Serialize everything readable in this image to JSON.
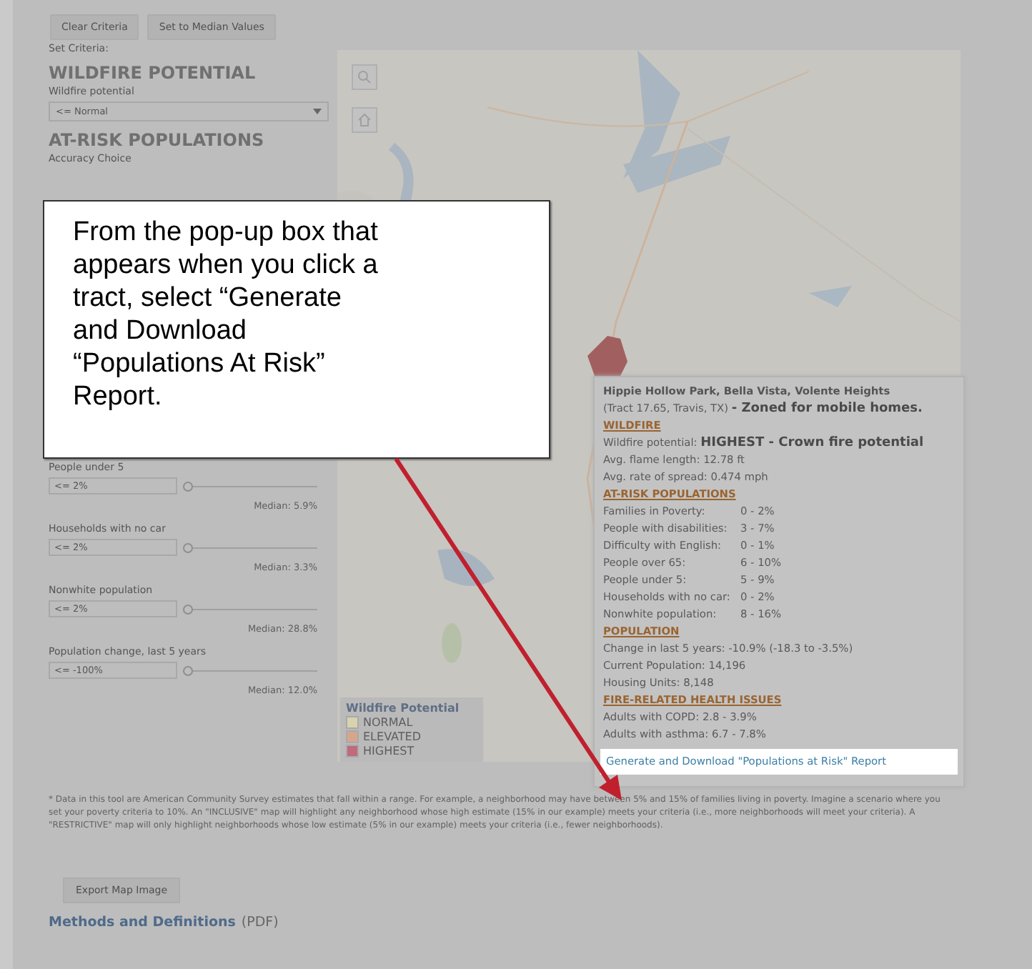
{
  "toolbar": {
    "buttons": [
      "Clear Criteria",
      "Set to Median Values"
    ]
  },
  "criteria_label": "Set Criteria:",
  "wildfire": {
    "heading": "WILDFIRE POTENTIAL",
    "label": "Wildfire potential",
    "value": "<= Normal"
  },
  "at_risk": {
    "heading": "AT-RISK POPULATIONS",
    "label": "Accuracy Choice"
  },
  "filters": [
    {
      "label": "People under 5",
      "value": "<= 2%",
      "level": 0,
      "median": "Median: 5.9%"
    },
    {
      "label": "Households with no car",
      "value": "<= 2%",
      "level": 0,
      "median": "Median: 3.3%"
    },
    {
      "label": "Nonwhite population",
      "value": "<= 2%",
      "level": 0,
      "median": "Median: 28.8%"
    },
    {
      "label": "Population change, last 5 years",
      "value": "<= -100%",
      "level": 0,
      "median": "Median: 12.0%"
    }
  ],
  "map": {
    "kind": "picture",
    "legend": {
      "title": "Wildfire Potential",
      "items": [
        {
          "label": "NORMAL",
          "color": "#d8d3ae"
        },
        {
          "label": "ELEVATED",
          "color": "#d6a58e"
        },
        {
          "label": "HIGHEST",
          "color": "#c06a7c"
        }
      ]
    }
  },
  "popup": {
    "title": "Hippie Hollow Park, Bella Vista, Volente Heights",
    "subtitle": "(Tract 17.65, Travis, TX) **- Zoned for mobile homes.**",
    "sections": [
      {
        "heading": "WILDFIRE",
        "rows": [
          {
            "kind": "line",
            "text": "Wildfire potential: **HIGHEST - Crown fire potential**"
          },
          {
            "kind": "line",
            "text": "Avg. flame length: 12.78 ft"
          },
          {
            "kind": "line",
            "text": "Avg. rate of spread: 0.474 mph"
          }
        ]
      },
      {
        "heading": "AT-RISK POPULATIONS",
        "rows": [
          {
            "kind": "pair",
            "label": "Families in Poverty:",
            "value": "0 - 2%"
          },
          {
            "kind": "pair",
            "label": "People with disabilities:",
            "value": "3 - 7%"
          },
          {
            "kind": "pair",
            "label": "Difficulty with English:",
            "value": "0 - 1%"
          },
          {
            "kind": "pair",
            "label": "People over 65:",
            "value": "6 - 10%"
          },
          {
            "kind": "pair",
            "label": "People under 5:",
            "value": "5 - 9%"
          },
          {
            "kind": "pair",
            "label": "Households with no car:",
            "value": "0 - 2%"
          },
          {
            "kind": "pair",
            "label": "Nonwhite population:",
            "value": "8 - 16%"
          }
        ]
      },
      {
        "heading": "POPULATION",
        "rows": [
          {
            "kind": "line",
            "text": "Change in last 5 years: -10.9% (-18.3 to -3.5%)"
          },
          {
            "kind": "line",
            "text": "Current Population: 14,196"
          },
          {
            "kind": "line",
            "text": "Housing Units: 8,148"
          }
        ]
      },
      {
        "heading": "FIRE-RELATED HEALTH ISSUES",
        "rows": [
          {
            "kind": "line",
            "text": "Adults with COPD: 2.8 - 3.9%"
          },
          {
            "kind": "line",
            "text": "Adults with asthma: 6.7 - 7.8%"
          }
        ]
      }
    ],
    "link": "Generate and Download \"Populations at Risk\" Report"
  },
  "footnote": "* Data in this tool are American Community Survey estimates that fall within a range. For example, a neighborhood may have between 5% and 15% of families living in poverty. Imagine a scenario where you set your poverty criteria to 10%. An \"INCLUSIVE\" map will highlight any neighborhood whose high estimate (15% in our example) meets your criteria (i.e., more neighborhoods will meet your criteria). A \"RESTRICTIVE\" map will only highlight neighborhoods whose low estimate (5% in our example) meets your criteria (i.e., fewer neighborhoods).",
  "export_button": "Export Map Image",
  "methods": {
    "link": "Methods and Definitions",
    "suffix": "(PDF)"
  },
  "callout": {
    "text": "From the pop-up box that\nappears when you click a\ntract, select “Generate\nand Download\n“Populations At Risk”\nReport."
  }
}
